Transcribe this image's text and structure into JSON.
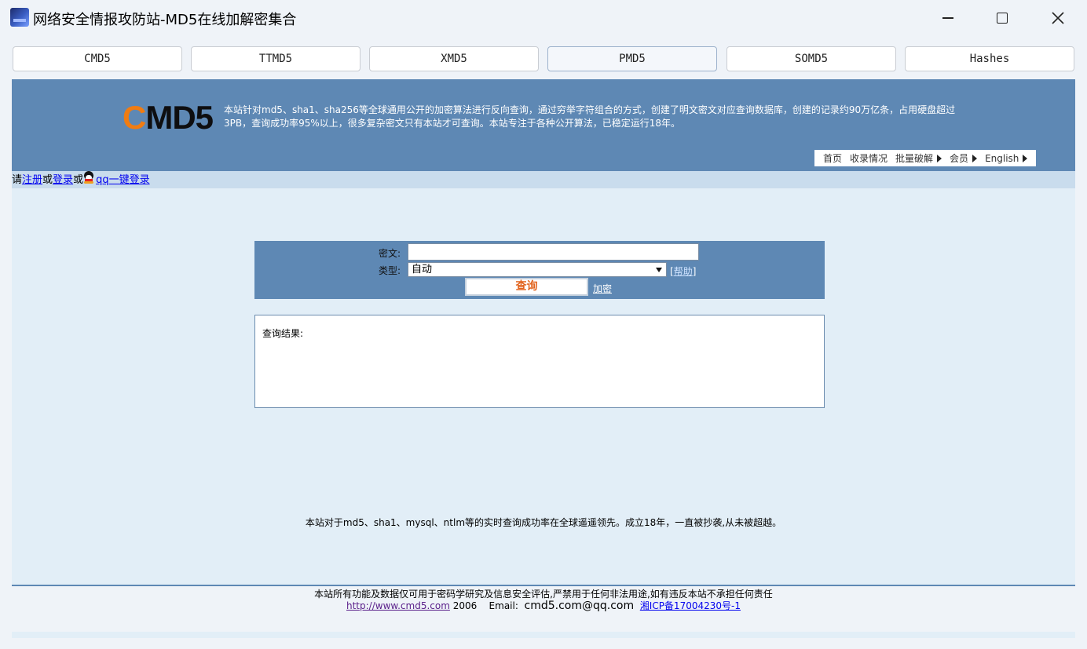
{
  "window": {
    "title": "网络安全情报攻防站-MD5在线加解密集合"
  },
  "tabs": [
    {
      "label": "CMD5"
    },
    {
      "label": "TTMD5"
    },
    {
      "label": "XMD5"
    },
    {
      "label": "PMD5"
    },
    {
      "label": "SOMD5"
    },
    {
      "label": "Hashes"
    }
  ],
  "active_tab": "PMD5",
  "header": {
    "logo_c": "C",
    "logo_rest": "MD5",
    "intro": "本站针对md5、sha1、sha256等全球通用公开的加密算法进行反向查询，通过穷举字符组合的方式，创建了明文密文对应查询数据库，创建的记录约90万亿条，占用硬盘超过3PB，查询成功率95%以上，很多复杂密文只有本站才可查询。本站专注于各种公开算法，已稳定运行18年。",
    "nav": [
      "首页",
      "收录情况",
      "批量破解",
      "会员",
      "English"
    ]
  },
  "login": {
    "prefix": "请",
    "register": "注册",
    "or1": "或",
    "login": "登录",
    "or2": "或",
    "qq_login": "qq一键登录"
  },
  "query": {
    "cipher_label": "密文:",
    "cipher_value": "",
    "type_label": "类型:",
    "type_value": "自动",
    "help_open": "[",
    "help_text": "帮助",
    "help_close": "]",
    "submit_label": "查询",
    "encrypt_link": "加密"
  },
  "result": {
    "label": "查询结果:"
  },
  "slogan": "本站对于md5、sha1、mysql、ntlm等的实时查询成功率在全球遥遥领先。成立18年，一直被抄袭,从未被超越。",
  "footer": {
    "disclaimer": "本站所有功能及数据仅可用于密码学研究及信息安全评估,严禁用于任何非法用途,如有违反本站不承担任何责任",
    "url": "http://www.cmd5.com",
    "year": "2006",
    "email_label": "Email:",
    "email": "cmd5.com@qq.com",
    "icp": "湘ICP备17004230号-1"
  },
  "colors": {
    "header_blue": "#5e88b4",
    "login_bar": "#c9dced",
    "main_bg": "#e2eef7",
    "logo_orange": "#f07c12",
    "query_orange": "#e2631d"
  }
}
